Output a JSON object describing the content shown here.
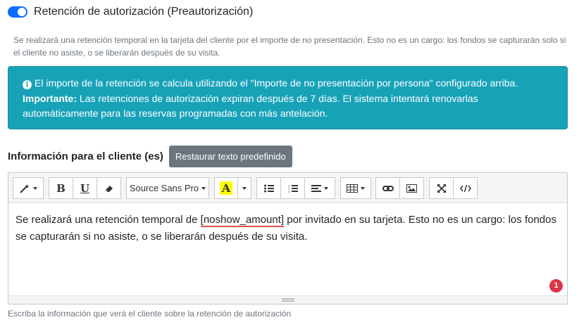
{
  "toggle": {
    "label": "Retención de autorización (Preautorización)",
    "checked": true,
    "color": "#0d6efd"
  },
  "help_top": "Se realizará una retención temporal en la tarjeta del cliente por el importe de no presentación. Esto no es un cargo: los fondos se capturarán solo si el cliente no asiste, o se liberarán después de su visita.",
  "alert": {
    "color": "#17a2b8",
    "icon": "info-circle-icon",
    "line1": "El importe de la retención se calcula utilizando el \"Importe de no presentación por persona\" configurado arriba.",
    "important_label": "Importante:",
    "important_text": "Las retenciones de autorización expiran después de 7 días. El sistema intentará renovarlas automáticamente para las reservas programadas con más antelación."
  },
  "section": {
    "title": "Información para el cliente (es)",
    "restore_button": "Restaurar texto predefinido"
  },
  "editor": {
    "toolbar": {
      "font_family": "Source Sans Pro",
      "bold": "B",
      "underline": "U",
      "highlight": "A",
      "icons": [
        "magic-wand-icon",
        "bold-icon",
        "underline-icon",
        "eraser-icon",
        "font-family-select",
        "text-color-icon",
        "color-dropdown-icon",
        "unordered-list-icon",
        "ordered-list-icon",
        "paragraph-align-icon",
        "table-icon",
        "link-icon",
        "picture-icon",
        "fullscreen-icon",
        "code-view-icon"
      ]
    },
    "content": {
      "before": "Se realizará una retención temporal de ",
      "placeholder": "[noshow_amount]",
      "after": " por invitado en su tarjeta. Esto no es un cargo: los fondos se capturarán si no asiste, o se liberarán después de su visita."
    },
    "error_count": "1"
  },
  "help_bottom": "Escriba la información que verá el cliente sobre la retención de autorización"
}
